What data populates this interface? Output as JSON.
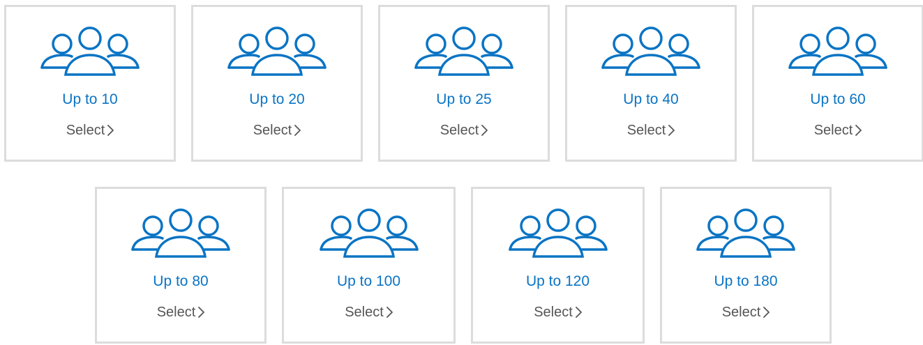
{
  "accent_color": "#0a74c4",
  "border_color": "#dcdcdc",
  "icon_name": "group-of-people-icon",
  "cards": [
    {
      "capacity_label": "Up to 10",
      "select_label": "Select"
    },
    {
      "capacity_label": "Up to 20",
      "select_label": "Select"
    },
    {
      "capacity_label": "Up to 25",
      "select_label": "Select"
    },
    {
      "capacity_label": "Up to 40",
      "select_label": "Select"
    },
    {
      "capacity_label": "Up to 60",
      "select_label": "Select"
    },
    {
      "capacity_label": "Up to 80",
      "select_label": "Select"
    },
    {
      "capacity_label": "Up to 100",
      "select_label": "Select"
    },
    {
      "capacity_label": "Up to 120",
      "select_label": "Select"
    },
    {
      "capacity_label": "Up to 180",
      "select_label": "Select"
    }
  ]
}
